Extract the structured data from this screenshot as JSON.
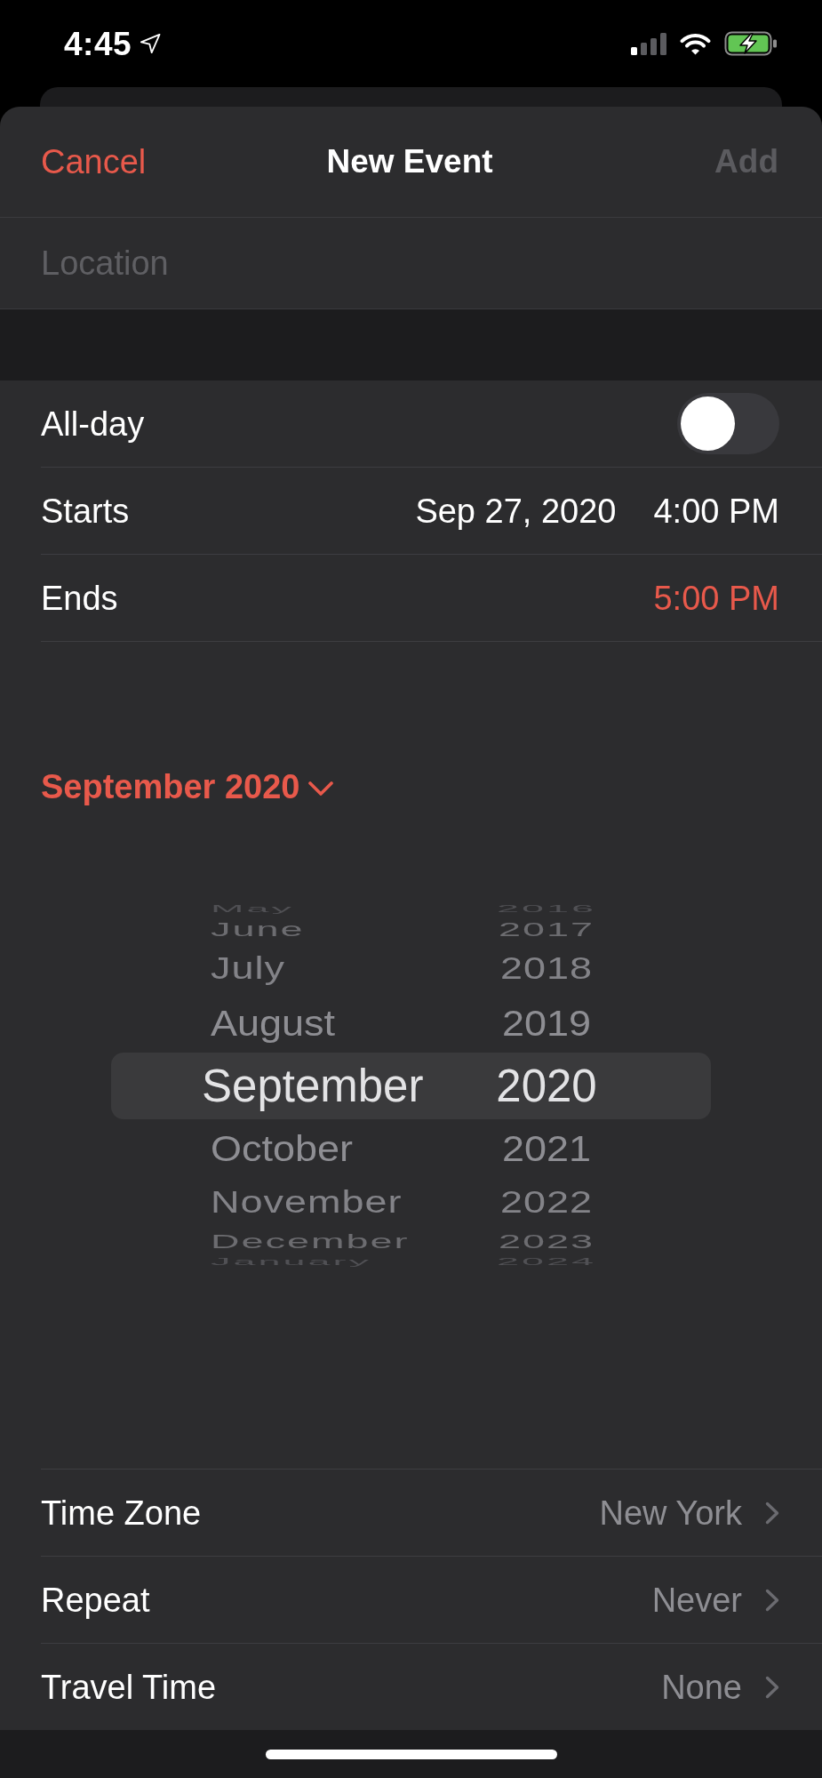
{
  "status_bar": {
    "time": "4:45"
  },
  "header": {
    "cancel": "Cancel",
    "title": "New Event",
    "add": {
      "label": "Add",
      "disabled": true
    }
  },
  "location": {
    "placeholder": "Location"
  },
  "event_rows": [
    {
      "kind": "toggle",
      "label": "All-day",
      "on": false
    },
    {
      "kind": "datetime",
      "label": "Starts",
      "values": [
        {
          "text": "Sep 27, 2020",
          "selected": false
        },
        {
          "text": "4:00 PM",
          "selected": false
        }
      ]
    },
    {
      "kind": "datetime",
      "label": "Ends",
      "values": [
        {
          "text": "5:00 PM",
          "selected": true
        }
      ]
    }
  ],
  "date_picker": {
    "month_label": "September 2020",
    "expanded": true,
    "months": [
      {
        "label": "May",
        "selected": false
      },
      {
        "label": "June",
        "selected": false
      },
      {
        "label": "July",
        "selected": false
      },
      {
        "label": "August",
        "selected": false
      },
      {
        "label": "September",
        "selected": true
      },
      {
        "label": "October",
        "selected": false
      },
      {
        "label": "November",
        "selected": false
      },
      {
        "label": "December",
        "selected": false
      },
      {
        "label": "January",
        "selected": false
      }
    ],
    "years": [
      {
        "label": "2016",
        "selected": false
      },
      {
        "label": "2017",
        "selected": false
      },
      {
        "label": "2018",
        "selected": false
      },
      {
        "label": "2019",
        "selected": false
      },
      {
        "label": "2020",
        "selected": true
      },
      {
        "label": "2021",
        "selected": false
      },
      {
        "label": "2022",
        "selected": false
      },
      {
        "label": "2023",
        "selected": false
      },
      {
        "label": "2024",
        "selected": false
      }
    ]
  },
  "details": [
    {
      "label": "Time Zone",
      "value": "New York"
    },
    {
      "label": "Repeat",
      "value": "Never"
    },
    {
      "label": "Travel Time",
      "value": "None"
    }
  ]
}
